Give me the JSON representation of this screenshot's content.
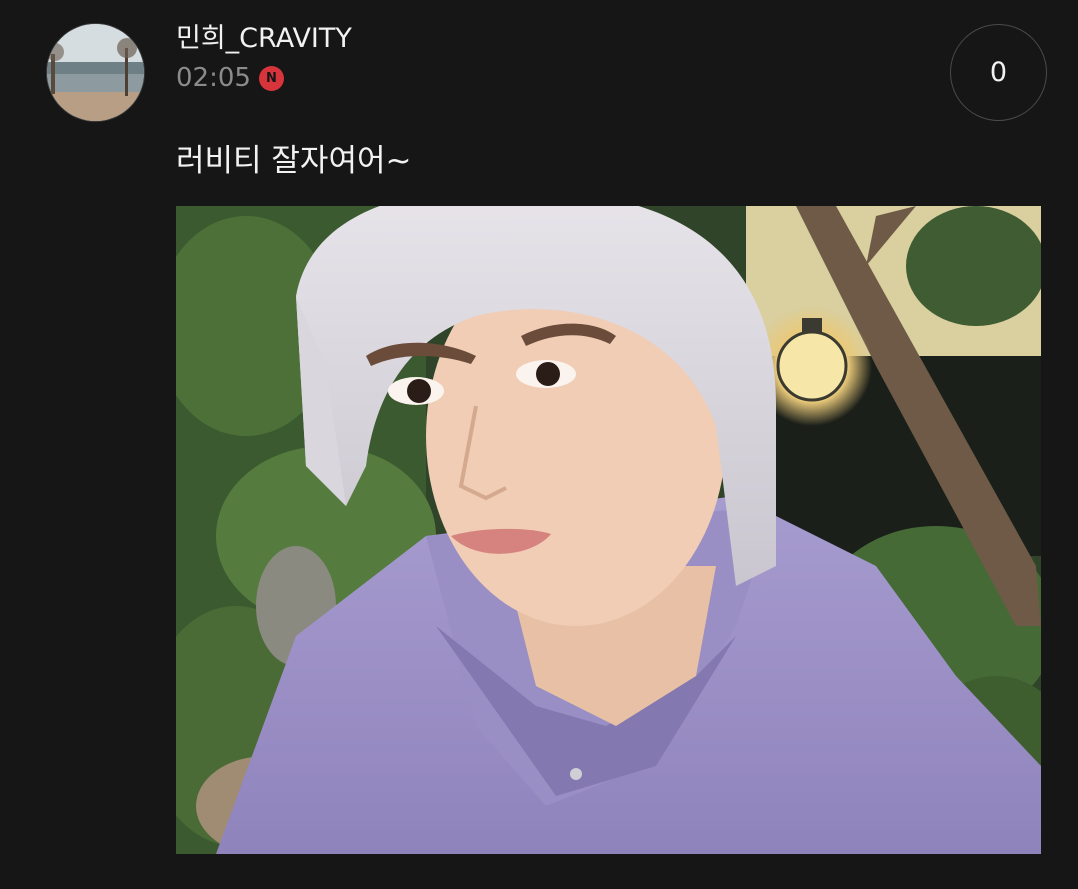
{
  "post": {
    "author": {
      "name": "민희_CRAVITY",
      "avatar_icon": "landscape-avatar"
    },
    "timestamp": "02:05",
    "new_badge": "N",
    "like_count": "0",
    "text": "러비티 잘자여어~",
    "image_icon": "selfie-photo"
  },
  "colors": {
    "background": "#161616",
    "badge": "#d8343b",
    "timestamp": "#8b8b8b",
    "text": "#f2f2f2"
  }
}
